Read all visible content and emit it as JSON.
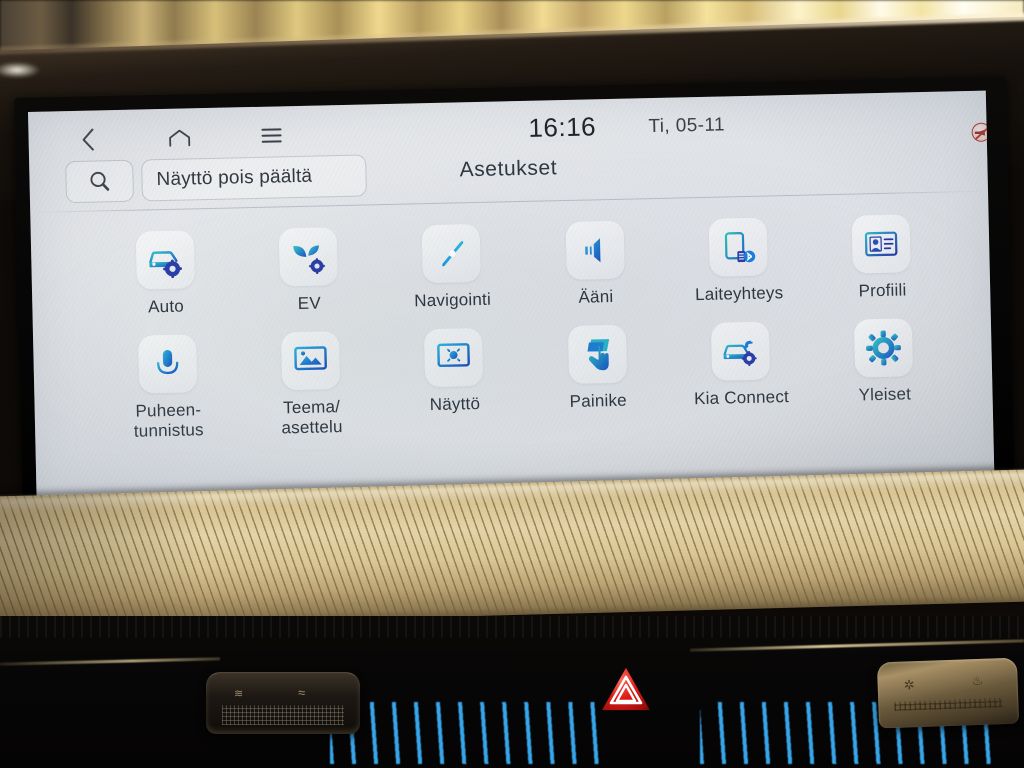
{
  "statusbar": {
    "back_icon": "chevron-left-icon",
    "home_icon": "home-icon",
    "menu_icon": "hamburger-menu-icon",
    "time": "16:16",
    "date": "Ti, 05-11",
    "mute_badge_icon": "sound-muted-icon"
  },
  "toolbar": {
    "search_icon": "search-icon",
    "display_off_label": "Näyttö pois päältä",
    "page_title": "Asetukset"
  },
  "grid": {
    "row1": [
      {
        "label": "Auto",
        "icon": "car-settings-icon"
      },
      {
        "label": "EV",
        "icon": "leaf-settings-icon"
      },
      {
        "label": "Navigointi",
        "icon": "compass-navigation-icon"
      },
      {
        "label": "Ääni",
        "icon": "speaker-sound-icon"
      },
      {
        "label": "Laiteyhteys",
        "icon": "phone-bluetooth-icon"
      },
      {
        "label": "Profiili",
        "icon": "id-card-profile-icon"
      }
    ],
    "row2": [
      {
        "label": "Puheen-\ntunnistus",
        "icon": "microphone-icon"
      },
      {
        "label": "Teema/\nasettelu",
        "icon": "monitor-image-icon"
      },
      {
        "label": "Näyttö",
        "icon": "monitor-brightness-icon"
      },
      {
        "label": "Painike",
        "icon": "hand-touch-button-icon"
      },
      {
        "label": "Kia Connect",
        "icon": "car-connected-icon"
      },
      {
        "label": "Yleiset",
        "icon": "gear-icon"
      }
    ]
  },
  "hardware": {
    "hazard_button_icon": "hazard-triangle-icon",
    "speaker_grille_icon": "speaker-grille",
    "right_controls_icon": "seat-heater-controls"
  },
  "colors": {
    "icon_cyan": "#2fb5c9",
    "icon_blue": "#1f6fd0",
    "icon_deep": "#243f9b",
    "text": "#2f3841",
    "title": "#2e3942",
    "hazard_red": "#e01d18",
    "ambient_blue": "#3ca8f5"
  }
}
